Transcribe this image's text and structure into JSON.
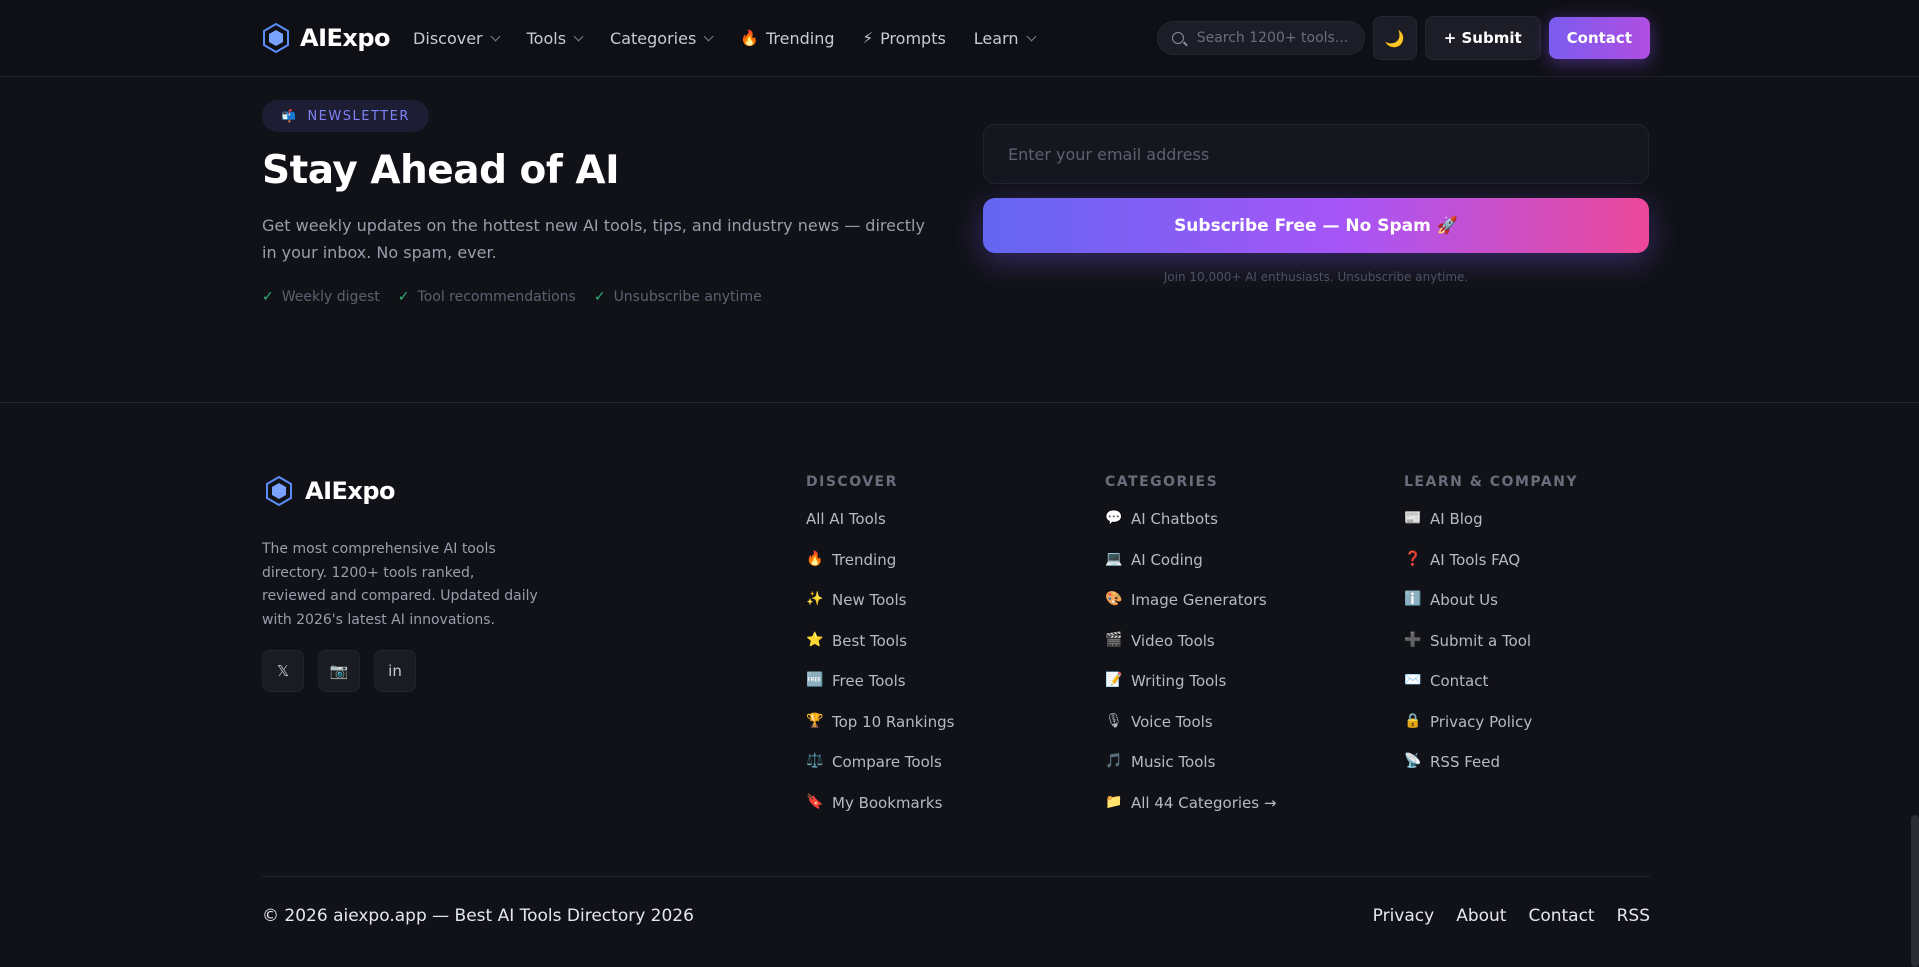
{
  "brand": {
    "name": "AIExpo"
  },
  "nav": {
    "links": [
      {
        "label": "Discover",
        "dropdown": true,
        "icon": ""
      },
      {
        "label": "Tools",
        "dropdown": true,
        "icon": ""
      },
      {
        "label": "Categories",
        "dropdown": true,
        "icon": ""
      },
      {
        "label": "Trending",
        "dropdown": false,
        "icon": "🔥"
      },
      {
        "label": "Prompts",
        "dropdown": false,
        "icon": "⚡"
      },
      {
        "label": "Learn",
        "dropdown": true,
        "icon": ""
      }
    ],
    "search_placeholder": "Search 1200+ tools...",
    "theme_icon": "🌙",
    "submit_label": "+ Submit",
    "contact_label": "Contact"
  },
  "newsletter": {
    "badge_icon": "📬",
    "badge": "NEWSLETTER",
    "title": "Stay Ahead of AI",
    "description": "Get weekly updates on the hottest new AI tools, tips, and industry news — directly in your inbox. No spam, ever.",
    "checks": [
      "Weekly digest",
      "Tool recommendations",
      "Unsubscribe anytime"
    ],
    "email_placeholder": "Enter your email address",
    "subscribe_label": "Subscribe Free — No Spam 🚀",
    "join_text": "Join 10,000+ AI enthusiasts. Unsubscribe anytime."
  },
  "footer": {
    "description": "The most comprehensive AI tools directory. 1200+ tools ranked, reviewed and compared. Updated daily with 2026's latest AI innovations.",
    "socials": [
      {
        "name": "x-icon",
        "glyph": "𝕏"
      },
      {
        "name": "instagram-icon",
        "glyph": "📷"
      },
      {
        "name": "linkedin-icon",
        "glyph": "in"
      }
    ],
    "columns": [
      {
        "title": "DISCOVER",
        "items": [
          {
            "icon": "",
            "label": "All AI Tools"
          },
          {
            "icon": "🔥",
            "label": "Trending"
          },
          {
            "icon": "✨",
            "label": "New Tools"
          },
          {
            "icon": "⭐",
            "label": "Best Tools"
          },
          {
            "icon": "🆓",
            "label": "Free Tools"
          },
          {
            "icon": "🏆",
            "label": "Top 10 Rankings"
          },
          {
            "icon": "⚖️",
            "label": "Compare Tools"
          },
          {
            "icon": "🔖",
            "label": "My Bookmarks"
          }
        ]
      },
      {
        "title": "CATEGORIES",
        "items": [
          {
            "icon": "💬",
            "label": "AI Chatbots"
          },
          {
            "icon": "💻",
            "label": "AI Coding"
          },
          {
            "icon": "🎨",
            "label": "Image Generators"
          },
          {
            "icon": "🎬",
            "label": "Video Tools"
          },
          {
            "icon": "📝",
            "label": "Writing Tools"
          },
          {
            "icon": "🎙",
            "label": "Voice Tools"
          },
          {
            "icon": "🎵",
            "label": "Music Tools"
          },
          {
            "icon": "📁",
            "label": "All 44 Categories →"
          }
        ]
      },
      {
        "title": "LEARN & COMPANY",
        "items": [
          {
            "icon": "📰",
            "label": "AI Blog"
          },
          {
            "icon": "❓",
            "label": "AI Tools FAQ"
          },
          {
            "icon": "ℹ️",
            "label": "About Us"
          },
          {
            "icon": "➕",
            "label": "Submit a Tool"
          },
          {
            "icon": "✉️",
            "label": "Contact"
          },
          {
            "icon": "🔒",
            "label": "Privacy Policy"
          },
          {
            "icon": "📡",
            "label": "RSS Feed"
          }
        ]
      }
    ],
    "copyright": "© 2026 aiexpo.app — Best AI Tools Directory 2026",
    "bottom_links": [
      "Privacy",
      "About",
      "Contact",
      "RSS"
    ]
  },
  "colors": {
    "background": "#111218",
    "accent": "#6366f1",
    "accent_pink": "#ec4899",
    "check": "#2db37a"
  }
}
